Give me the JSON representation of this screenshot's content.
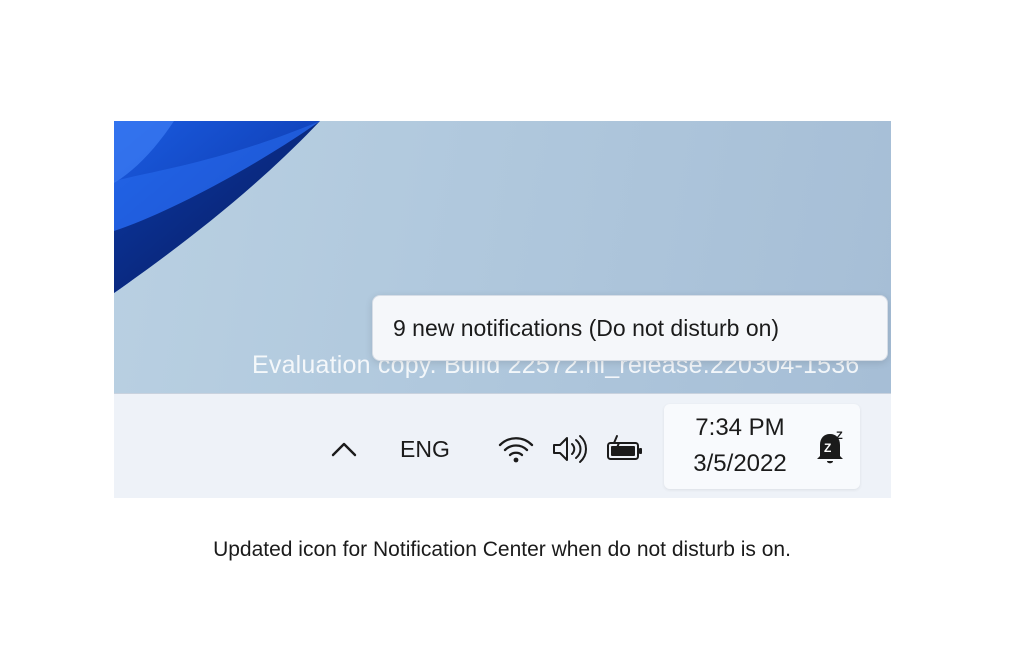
{
  "desktop": {
    "watermark": "Evaluation copy. Build 22572.ni_release.220304-1536"
  },
  "tooltip": {
    "text": "9 new notifications (Do not disturb on)"
  },
  "taskbar": {
    "language": "ENG",
    "icons": {
      "overflow": "chevron-up-icon",
      "network": "wifi-icon",
      "sound": "volume-icon",
      "power": "battery-charging-icon",
      "notifications": "bell-snooze-icon"
    },
    "clock": {
      "time": "7:34 PM",
      "date": "3/5/2022"
    }
  },
  "caption": "Updated icon for Notification Center when do not disturb is on.",
  "colors": {
    "taskbar_bg": "#eef2f8",
    "wallpaper_blue": "#1046c8",
    "tooltip_bg": "#f5f7fa"
  }
}
